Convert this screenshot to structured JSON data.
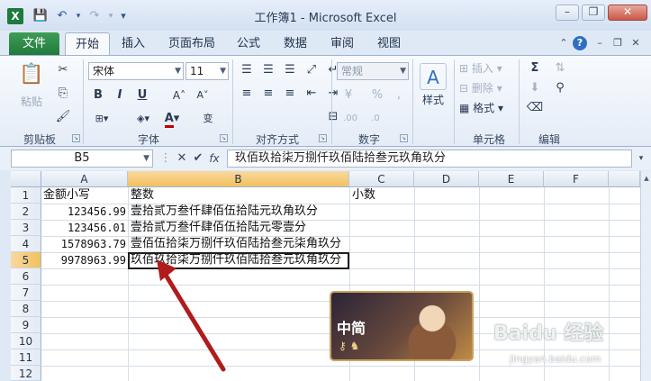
{
  "window": {
    "title": "工作簿1 - Microsoft Excel",
    "logo_letter": "X",
    "min": "–",
    "restore": "❐",
    "close": "✕"
  },
  "qat": {
    "save": "💾",
    "undo": "↶",
    "redo": "↷",
    "customize": "▾"
  },
  "tabs": [
    {
      "label": "文件"
    },
    {
      "label": "开始"
    },
    {
      "label": "插入"
    },
    {
      "label": "页面布局"
    },
    {
      "label": "公式"
    },
    {
      "label": "数据"
    },
    {
      "label": "审阅"
    },
    {
      "label": "视图"
    }
  ],
  "ribbon": {
    "clipboard": {
      "paste": "粘贴",
      "group": "剪贴板"
    },
    "font": {
      "name": "宋体",
      "size": "11",
      "bold": "B",
      "italic": "I",
      "underline": "U",
      "grow": "A˄",
      "shrink": "A˅",
      "color_letter": "A",
      "font_color": "#c00000",
      "phonetic": "变",
      "group": "字体"
    },
    "alignment": {
      "group": "对齐方式"
    },
    "number": {
      "format": "常规",
      "percent": "%",
      "comma": ",",
      "group": "数字"
    },
    "styles": {
      "label": "样式"
    },
    "cells": {
      "insert": "插入",
      "delete": "删除",
      "format": "格式",
      "group": "单元格"
    },
    "editing": {
      "sum": "Σ",
      "group": "编辑"
    }
  },
  "formula_bar": {
    "name_box": "B5",
    "cancel": "✕",
    "enter": "✔",
    "fx": "fx",
    "content": "玖佰玖拾柒万捌仟玖佰陆拾叁元玖角玖分"
  },
  "columns": [
    "A",
    "B",
    "C",
    "D",
    "E",
    "F"
  ],
  "rows": [
    "1",
    "2",
    "3",
    "4",
    "5",
    "6",
    "7",
    "8",
    "9",
    "10",
    "11",
    "12"
  ],
  "cells": {
    "A1": "金额小写",
    "B1": "整数",
    "C1": "小数",
    "A2": "123456.99",
    "B2": "壹拾贰万叁仟肆佰伍拾陆元玖角玖分",
    "A3": "123456.01",
    "B3": "壹拾贰万叁仟肆佰伍拾陆元零壹分",
    "A4": "1578963.79",
    "B4": "壹佰伍拾柒万捌仟玖佰陆拾叁元柒角玖分",
    "A5": "9978963.99",
    "B5": "玖佰玖拾柒万捌仟玖佰陆拾叁元玖角玖分"
  },
  "overlay": {
    "badge_text": "中简",
    "badge_icons": "⚷ ♞",
    "watermark": "Baidu 经验",
    "watermark_sub": "jingyan.baidu.com",
    "arrow_color": "#b01c1c"
  }
}
